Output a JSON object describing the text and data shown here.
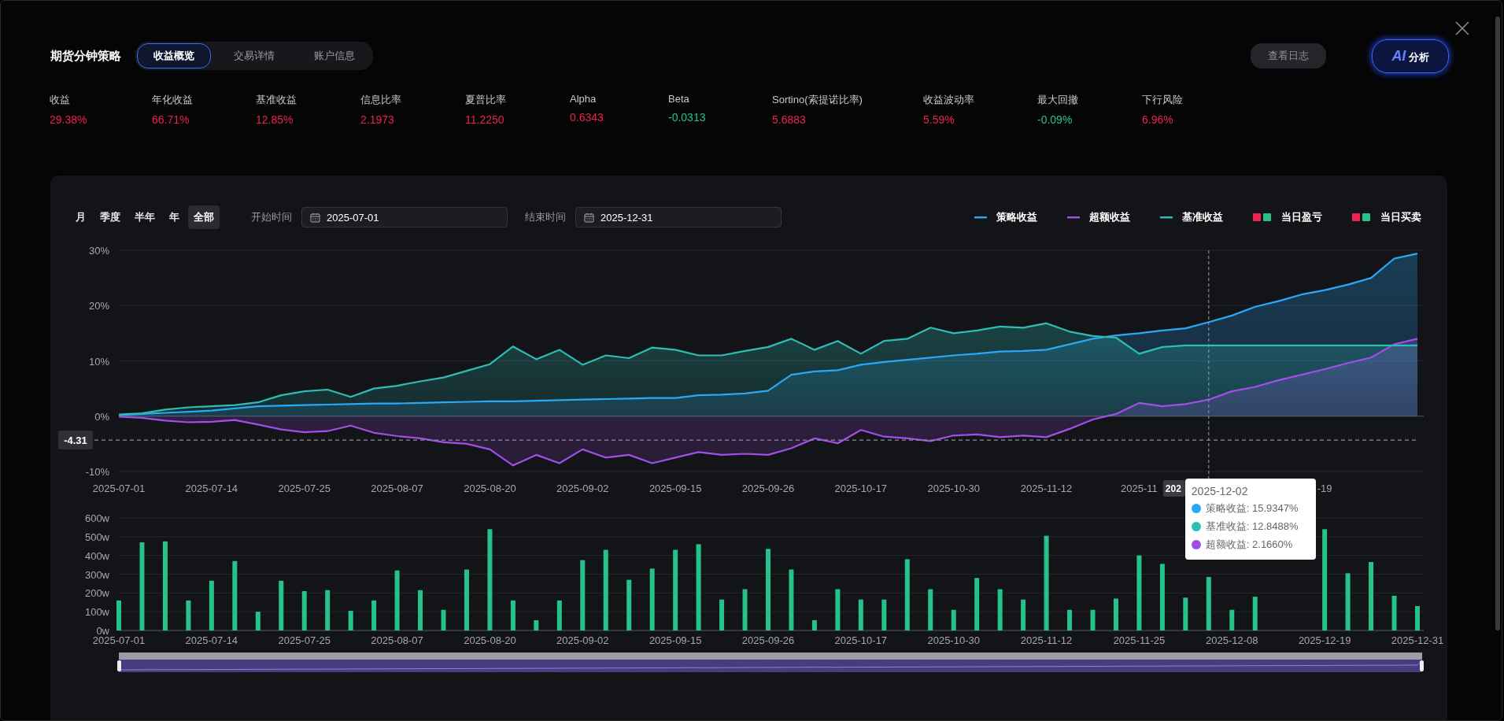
{
  "header": {
    "title": "期货分钟策略",
    "tabs": [
      {
        "label": "收益概览",
        "selected": true
      },
      {
        "label": "交易详情",
        "selected": false
      },
      {
        "label": "账户信息",
        "selected": false
      }
    ],
    "log_button": "查看日志",
    "ai_button": {
      "badge": "AI",
      "label": "分析"
    }
  },
  "metrics": [
    {
      "label": "收益",
      "value": "29.38%",
      "color": "#f0224f"
    },
    {
      "label": "年化收益",
      "value": "66.71%",
      "color": "#f0224f"
    },
    {
      "label": "基准收益",
      "value": "12.85%",
      "color": "#f0224f"
    },
    {
      "label": "信息比率",
      "value": "2.1973",
      "color": "#f0224f"
    },
    {
      "label": "夏普比率",
      "value": "11.2250",
      "color": "#f0224f"
    },
    {
      "label": "Alpha",
      "value": "0.6343",
      "color": "#f0224f"
    },
    {
      "label": "Beta",
      "value": "-0.0313",
      "color": "#22c48b"
    },
    {
      "label": "Sortino(索提诺比率)",
      "value": "5.6883",
      "color": "#f0224f"
    },
    {
      "label": "收益波动率",
      "value": "5.59%",
      "color": "#f0224f"
    },
    {
      "label": "最大回撤",
      "value": "-0.09%",
      "color": "#22c48b"
    },
    {
      "label": "下行风险",
      "value": "6.96%",
      "color": "#f0224f"
    }
  ],
  "periods": [
    {
      "label": "月",
      "selected": false
    },
    {
      "label": "季度",
      "selected": false
    },
    {
      "label": "半年",
      "selected": false
    },
    {
      "label": "年",
      "selected": false
    },
    {
      "label": "全部",
      "selected": true
    }
  ],
  "start": {
    "label": "开始时间",
    "value": "2025-07-01"
  },
  "end": {
    "label": "结束时间",
    "value": "2025-12-31"
  },
  "legend_extra": {
    "label": "当日盈亏",
    "color": "#f0224f"
  },
  "returns_chart": {
    "chart_data": {
      "type": "area",
      "grid": true,
      "categories": [
        "2025-07-01",
        null,
        null,
        null,
        "2025-07-14",
        null,
        null,
        null,
        "2025-07-25",
        null,
        null,
        null,
        "2025-08-07",
        null,
        null,
        null,
        "2025-08-20",
        null,
        null,
        null,
        "2025-09-02",
        null,
        null,
        null,
        "2025-09-15",
        null,
        null,
        null,
        "2025-09-26",
        null,
        null,
        null,
        "2025-10-17",
        null,
        null,
        null,
        "2025-10-30",
        null,
        null,
        null,
        "2025-11-12",
        null,
        null,
        null,
        "2025-11",
        null,
        null,
        null,
        null,
        null,
        null,
        null,
        "-19",
        null,
        null,
        null,
        null
      ],
      "series": [
        {
          "name": "策略收益",
          "color": "#2aa8f8",
          "values": [
            0.2,
            0.4,
            0.6,
            0.8,
            1.0,
            1.4,
            1.8,
            1.9,
            2.0,
            2.1,
            2.2,
            2.3,
            2.3,
            2.4,
            2.5,
            2.6,
            2.7,
            2.7,
            2.8,
            2.9,
            3.0,
            3.1,
            3.2,
            3.3,
            3.3,
            3.8,
            3.9,
            4.1,
            4.6,
            7.5,
            8.1,
            8.3,
            9.3,
            9.8,
            10.2,
            10.6,
            11.0,
            11.3,
            11.7,
            11.8,
            12.0,
            13.0,
            14.0,
            14.6,
            15.0,
            15.5,
            15.9,
            17.0,
            18.2,
            19.8,
            20.8,
            22.0,
            22.8,
            23.8,
            25.0,
            28.5,
            29.4
          ]
        },
        {
          "name": "超额收益",
          "color": "#a24ee8",
          "values": [
            -0.1,
            -0.3,
            -0.8,
            -1.1,
            -1.0,
            -0.7,
            -1.5,
            -2.4,
            -2.9,
            -2.7,
            -1.7,
            -3.0,
            -3.6,
            -4.0,
            -4.7,
            -5.0,
            -6.0,
            -8.9,
            -7.0,
            -8.5,
            -6.0,
            -7.5,
            -7.0,
            -8.5,
            -7.5,
            -6.5,
            -7.0,
            -6.8,
            -7.0,
            -5.8,
            -4.0,
            -4.9,
            -2.5,
            -3.7,
            -4.0,
            -4.5,
            -3.5,
            -3.3,
            -3.8,
            -3.5,
            -3.8,
            -2.3,
            -0.6,
            0.4,
            2.4,
            1.8,
            2.2,
            3.0,
            4.5,
            5.3,
            6.5,
            7.5,
            8.5,
            9.6,
            10.6,
            13.0,
            14.0
          ]
        },
        {
          "name": "基准收益",
          "color": "#2ebdb4",
          "values": [
            0.3,
            0.5,
            1.2,
            1.6,
            1.8,
            2.0,
            2.5,
            3.8,
            4.5,
            4.8,
            3.5,
            5.0,
            5.5,
            6.3,
            7.0,
            8.2,
            9.4,
            12.6,
            10.3,
            12.0,
            9.3,
            11.0,
            10.5,
            12.4,
            12.0,
            11.0,
            11.0,
            11.8,
            12.5,
            14.0,
            12.0,
            13.6,
            11.3,
            13.6,
            14.0,
            16.0,
            15.0,
            15.5,
            16.2,
            16.0,
            16.8,
            15.3,
            14.5,
            14.2,
            11.3,
            12.5,
            12.8,
            12.8,
            12.8,
            12.8,
            12.8,
            12.8,
            12.8,
            12.8,
            12.8,
            12.8,
            12.8
          ]
        }
      ],
      "ylim": [
        -10,
        30
      ],
      "yticks": [
        {
          "value": 30,
          "label": "30%"
        },
        {
          "value": 20,
          "label": "20%"
        },
        {
          "value": 10,
          "label": "10%"
        },
        {
          "value": 0,
          "label": "0%"
        },
        {
          "value": -10,
          "label": "-10%"
        }
      ],
      "ref_lines": [
        {
          "axis": "y",
          "value": -4.31,
          "label": "-4.31"
        }
      ]
    },
    "pointer": {
      "label": "202"
    },
    "tooltip": {
      "date": "2025-12-02",
      "rows": [
        {
          "text": "策略收益: 15.9347%",
          "color": "#2aa8f8"
        },
        {
          "text": "基准收益: 12.8488%",
          "color": "#2ebdb4"
        },
        {
          "text": "超额收益: 2.1660%",
          "color": "#a24ee8"
        }
      ]
    }
  },
  "volume_chart": {
    "chart_data": {
      "type": "bar",
      "grid": true,
      "categories": [
        "2025-07-01",
        null,
        null,
        null,
        "2025-07-14",
        null,
        null,
        null,
        "2025-07-25",
        null,
        null,
        null,
        "2025-08-07",
        null,
        null,
        null,
        "2025-08-20",
        null,
        null,
        null,
        "2025-09-02",
        null,
        null,
        null,
        "2025-09-15",
        null,
        null,
        null,
        "2025-09-26",
        null,
        null,
        null,
        "2025-10-17",
        null,
        null,
        null,
        "2025-10-30",
        null,
        null,
        null,
        "2025-11-12",
        null,
        null,
        null,
        "2025-11-25",
        null,
        null,
        null,
        "2025-12-08",
        null,
        null,
        null,
        "2025-12-19",
        null,
        null,
        null,
        "2025-12-31"
      ],
      "series": [
        {
          "name": "当日买卖",
          "color": "#26c28a",
          "values": [
            160,
            470,
            475,
            160,
            265,
            370,
            100,
            265,
            210,
            215,
            105,
            160,
            320,
            215,
            110,
            325,
            540,
            160,
            55,
            160,
            375,
            430,
            270,
            330,
            430,
            460,
            165,
            220,
            435,
            325,
            55,
            220,
            165,
            165,
            380,
            220,
            110,
            280,
            220,
            165,
            505,
            110,
            110,
            170,
            400,
            355,
            175,
            285,
            110,
            180,
            null,
            null,
            540,
            305,
            365,
            185,
            130
          ]
        }
      ],
      "ylim": [
        0,
        600
      ],
      "yticks": [
        {
          "value": 600,
          "label": "600w"
        },
        {
          "value": 500,
          "label": "500w"
        },
        {
          "value": 400,
          "label": "400w"
        },
        {
          "value": 300,
          "label": "300w"
        },
        {
          "value": 200,
          "label": "200w"
        },
        {
          "value": 100,
          "label": "100w"
        },
        {
          "value": 0,
          "label": "0w"
        }
      ]
    }
  }
}
